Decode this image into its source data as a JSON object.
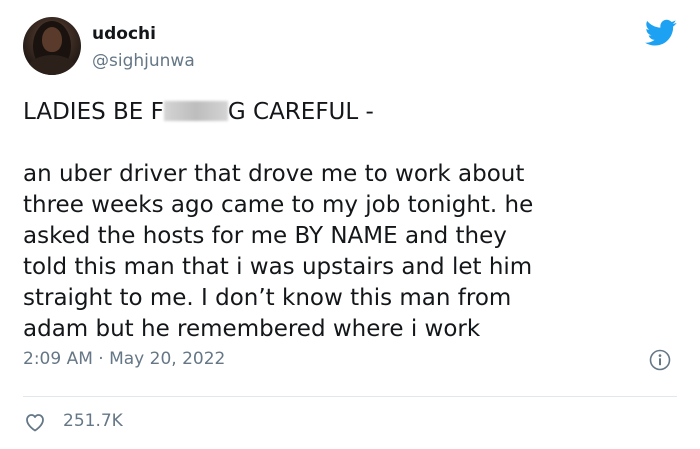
{
  "user": {
    "display_name": "udochi",
    "handle": "@sighjunwa",
    "avatar_icon": "user-avatar"
  },
  "brand": {
    "logo_icon": "twitter-bird-icon",
    "color": "#1da1f2"
  },
  "tweet": {
    "headline_before": "LADIES BE F",
    "headline_after": "G CAREFUL -",
    "lines": [
      "an uber driver that drove me to work about",
      "three weeks ago came to my job tonight. he",
      "asked the hosts for me BY NAME and they",
      "told this man that i was upstairs and let him",
      "straight to me. I don’t know this man from",
      "adam but he remembered where i work"
    ],
    "timestamp": "2:09 AM · May 20, 2022"
  },
  "engagement": {
    "likes": "251.7K",
    "like_icon": "heart-icon",
    "info_icon": "info-icon"
  },
  "colors": {
    "text": "#14171a",
    "secondary": "#657786",
    "divider": "#e1e8ed"
  }
}
